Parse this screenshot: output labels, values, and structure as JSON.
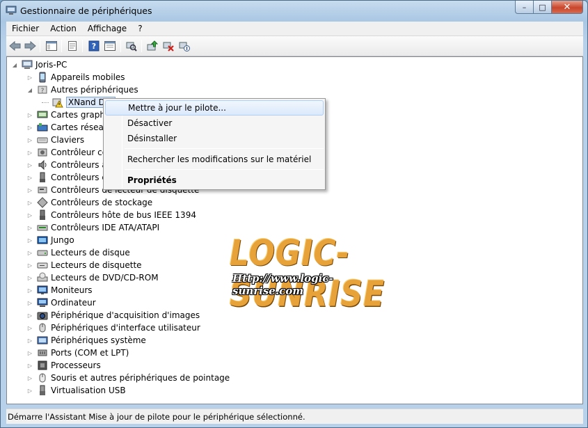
{
  "window": {
    "title": "Gestionnaire de périphériques",
    "controls": {
      "minimize": "–",
      "maximize": "□",
      "close": "✕"
    }
  },
  "menubar": {
    "items": [
      "Fichier",
      "Action",
      "Affichage",
      "?"
    ]
  },
  "toolbar": {
    "buttons": [
      "back-icon",
      "forward-icon",
      "show-hide-console-tree-icon",
      "properties-icon",
      "help-icon",
      "console-icon",
      "scan-hardware-icon",
      "update-driver-icon",
      "uninstall-icon",
      "disable-icon"
    ]
  },
  "tree": {
    "root": "Joris-PC",
    "items": [
      {
        "label": "Appareils mobiles",
        "icon": "mobile-device-icon",
        "expanded": false
      },
      {
        "label": "Autres périphériques",
        "icon": "unknown-device-icon",
        "expanded": true
      },
      {
        "label": "XNand Dur",
        "icon": "warning-device-icon",
        "child": true,
        "selected": true
      },
      {
        "label": "Cartes graphiq",
        "icon": "display-adapter-icon"
      },
      {
        "label": "Cartes réseau",
        "icon": "network-adapter-icon"
      },
      {
        "label": "Claviers",
        "icon": "keyboard-icon"
      },
      {
        "label": "Contrôleur con",
        "icon": "controller-icon"
      },
      {
        "label": "Contrôleurs au",
        "icon": "audio-controller-icon"
      },
      {
        "label": "Contrôleurs de",
        "icon": "usb-controller-icon"
      },
      {
        "label": "Contrôleurs de lecteur de disquette",
        "icon": "floppy-controller-icon"
      },
      {
        "label": "Contrôleurs de stockage",
        "icon": "storage-controller-icon"
      },
      {
        "label": "Contrôleurs hôte de bus IEEE 1394",
        "icon": "ieee1394-icon"
      },
      {
        "label": "Contrôleurs IDE ATA/ATAPI",
        "icon": "ide-controller-icon"
      },
      {
        "label": "Jungo",
        "icon": "jungo-icon"
      },
      {
        "label": "Lecteurs de disque",
        "icon": "disk-drive-icon"
      },
      {
        "label": "Lecteurs de disquette",
        "icon": "floppy-drive-icon"
      },
      {
        "label": "Lecteurs de DVD/CD-ROM",
        "icon": "dvd-drive-icon"
      },
      {
        "label": "Moniteurs",
        "icon": "monitor-icon"
      },
      {
        "label": "Ordinateur",
        "icon": "computer-icon"
      },
      {
        "label": "Périphérique d'acquisition d'images",
        "icon": "camera-icon"
      },
      {
        "label": "Périphériques d'interface utilisateur",
        "icon": "hid-icon"
      },
      {
        "label": "Périphériques système",
        "icon": "system-device-icon"
      },
      {
        "label": "Ports (COM et LPT)",
        "icon": "port-icon"
      },
      {
        "label": "Processeurs",
        "icon": "processor-icon"
      },
      {
        "label": "Souris et autres périphériques de pointage",
        "icon": "mouse-icon"
      },
      {
        "label": "Virtualisation USB",
        "icon": "usb-icon"
      }
    ]
  },
  "context_menu": {
    "items": [
      {
        "label": "Mettre à jour le pilote...",
        "highlighted": true
      },
      {
        "label": "Désactiver"
      },
      {
        "label": "Désinstaller"
      },
      {
        "label": "Rechercher les modifications sur le matériel"
      },
      {
        "label": "Propriétés",
        "bold": true
      }
    ]
  },
  "watermark": {
    "title": "LOGIC-SUNRISE",
    "url": "Http://www.logic-sunrise.com"
  },
  "statusbar": {
    "text": "Démarre l'Assistant Mise à jour de pilote pour le périphérique sélectionné."
  },
  "colors": {
    "selection": "#dbe9fb",
    "watermark": "#e8a23a",
    "close_button": "#c9462c"
  }
}
